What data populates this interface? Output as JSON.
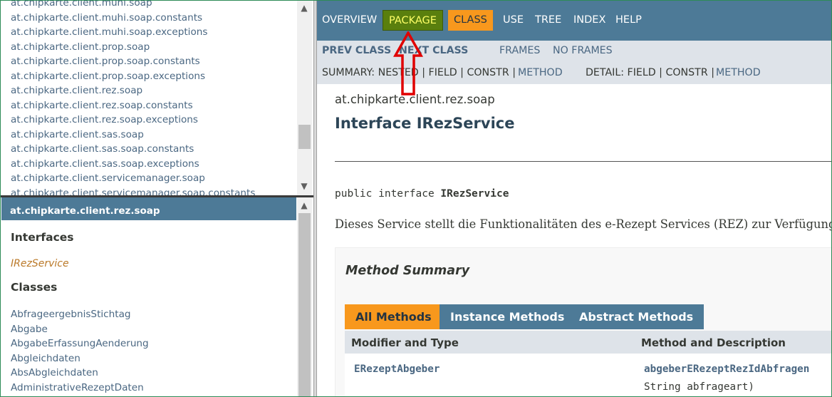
{
  "package_list": [
    "at.chipkarte.client.muhi.soap",
    "at.chipkarte.client.muhi.soap.constants",
    "at.chipkarte.client.muhi.soap.exceptions",
    "at.chipkarte.client.prop.soap",
    "at.chipkarte.client.prop.soap.constants",
    "at.chipkarte.client.prop.soap.exceptions",
    "at.chipkarte.client.rez.soap",
    "at.chipkarte.client.rez.soap.constants",
    "at.chipkarte.client.rez.soap.exceptions",
    "at.chipkarte.client.sas.soap",
    "at.chipkarte.client.sas.soap.constants",
    "at.chipkarte.client.sas.soap.exceptions",
    "at.chipkarte.client.servicemanager.soap",
    "at.chipkarte.client.servicemanager.soap.constants"
  ],
  "package_frame": {
    "title": "at.chipkarte.client.rez.soap",
    "interfaces_heading": "Interfaces",
    "interfaces": [
      "IRezService"
    ],
    "classes_heading": "Classes",
    "classes": [
      "AbfrageergebnisStichtag",
      "Abgabe",
      "AbgabeErfassungAenderung",
      "Abgleichdaten",
      "AbsAbgleichdaten",
      "AdministrativeRezeptDaten"
    ]
  },
  "topnav": {
    "overview": "OVERVIEW",
    "package": "PACKAGE",
    "class": "CLASS",
    "use": "USE",
    "tree": "TREE",
    "index": "INDEX",
    "help": "HELP"
  },
  "subnav": {
    "prev_class": "PREV CLASS",
    "next_class": "NEXT CLASS",
    "frames": "FRAMES",
    "no_frames": "NO FRAMES",
    "summary_label": "SUMMARY: NESTED | FIELD | CONSTR |",
    "summary_method": "METHOD",
    "detail_label": "DETAIL: FIELD | CONSTR |",
    "detail_method": "METHOD"
  },
  "content": {
    "package_name": "at.chipkarte.client.rez.soap",
    "class_title": "Interface IRezService",
    "declaration_prefix": "public interface ",
    "declaration_name": "IRezService",
    "description": "Dieses Service stellt die Funktionalitäten des e-Rezept Services (REZ) zur Verfügung."
  },
  "method_summary": {
    "title": "Method Summary",
    "tabs": [
      "All Methods",
      "Instance Methods",
      "Abstract Methods"
    ],
    "active_tab": "All Methods",
    "col_modifier": "Modifier and Type",
    "col_method": "Method and Description",
    "rows": [
      {
        "type": "ERezeptAbgeber",
        "method": "abgeberERezeptRezIdAbfragen",
        "params": "String abfrageart)"
      }
    ]
  },
  "colors": {
    "nav_bg": "#4d7a97",
    "subnav_bg": "#dee3e9",
    "active_orange": "#f8981d",
    "package_green": "#5a7f0e",
    "link": "#4a6782",
    "annotation_arrow": "#e00000"
  }
}
